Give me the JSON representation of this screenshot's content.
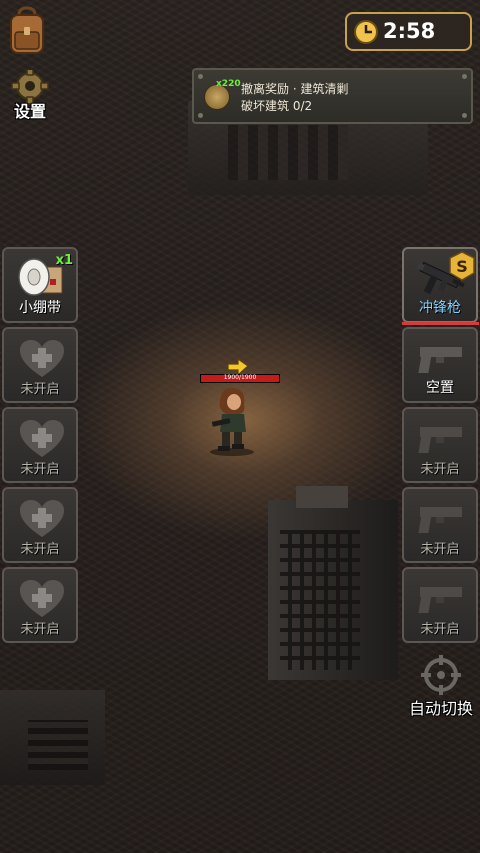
{
  "hud": {
    "settings_label": "设置",
    "timer": "2:58",
    "auto_switch_label": "自动切换"
  },
  "mission": {
    "reward_count": "x220",
    "title": "撤离奖励 · 建筑清剿",
    "progress": "破坏建筑 0/2"
  },
  "item_slots": [
    {
      "label": "小绷带",
      "count": "x1",
      "state": "filled"
    },
    {
      "label": "未开启",
      "state": "locked"
    },
    {
      "label": "未开启",
      "state": "locked"
    },
    {
      "label": "未开启",
      "state": "locked"
    },
    {
      "label": "未开启",
      "state": "locked"
    }
  ],
  "weapon_slots": [
    {
      "label": "冲锋枪",
      "badge": "S",
      "state": "equipped"
    },
    {
      "label": "空置",
      "state": "empty"
    },
    {
      "label": "未开启",
      "state": "locked"
    },
    {
      "label": "未开启",
      "state": "locked"
    },
    {
      "label": "未开启",
      "state": "locked"
    }
  ],
  "player": {
    "health_text": "1900/1900",
    "health_fraction": 1.0
  },
  "colors": {
    "accent_gold": "#c8a24a",
    "count_green": "#6cf03a",
    "weapon_blue": "#7fd0ff",
    "health_red": "#c51b1b"
  },
  "icons": [
    "backpack-icon",
    "gear-icon",
    "clock-icon",
    "medal-icon",
    "bandage-icon",
    "heart-plus-icon",
    "smg-icon",
    "pistol-icon",
    "crosshair-icon",
    "arrow-icon"
  ]
}
